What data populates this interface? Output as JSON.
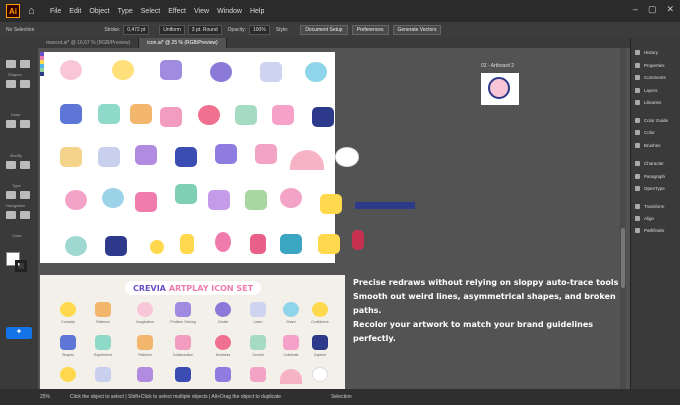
{
  "app": {
    "logo": "Ai"
  },
  "menu": [
    "File",
    "Edit",
    "Object",
    "Type",
    "Select",
    "Effect",
    "View",
    "Window",
    "Help"
  ],
  "control": {
    "selection": "No Selection",
    "stroke_label": "Stroke:",
    "stroke_value": "0,472 pt",
    "uniform": "Uniform",
    "brush": "3 pt. Round",
    "opacity_label": "Opacity:",
    "opacity_value": "100%",
    "style_label": "Style:",
    "doc_setup": "Document Setup",
    "preferences": "Preferences",
    "generate": "Generate Vectors"
  },
  "tabs": [
    "mascot.ai* @ 16,67 % (RGB/Preview)",
    "icon.ai* @ 25 % (RGB/Preview)"
  ],
  "toolbar_labels": [
    "Shapes",
    "Draw",
    "Modify",
    "Type",
    "Navigation",
    "Color"
  ],
  "artboard2_label": "02 - Artboard 2",
  "creva": {
    "title_a": "CREVIA",
    "title_b": "ARTPLAY ICON SET"
  },
  "icon_labels": [
    "Curiosity",
    "Patience",
    "Imagination",
    "Problem Solving",
    "Create",
    "Learn",
    "Share",
    "Confidence"
  ],
  "icon_labels_row2": [
    "Shapes",
    "Experiment",
    "Patience",
    "Collaboration",
    "Kindness",
    "Growth",
    "Celebrate",
    "Capture"
  ],
  "promo": [
    "Precise redraws without relying on sloppy auto-trace tools",
    "Smooth out weird lines, asymmetrical shapes, and broken paths.",
    "Recolor your artwork to match your brand guidelines perfectly."
  ],
  "panels": [
    "History",
    "Properties",
    "Comments",
    "Layers",
    "Libraries",
    "Color Guide",
    "Color",
    "Brushes",
    "Character",
    "Paragraph",
    "OpenType",
    "Transform",
    "Align",
    "Pathfinder"
  ],
  "status": {
    "zoom": "25%",
    "hint": "Click the object to select  |  Shift+Click to select multiple objects  |  Alt+Drag the object to duplicate",
    "tool": "Selection"
  },
  "colors": {
    "accent": "#f07cae",
    "purple": "#6a4fc5",
    "navy": "#2d3a8c",
    "yellow": "#ffd84d"
  }
}
